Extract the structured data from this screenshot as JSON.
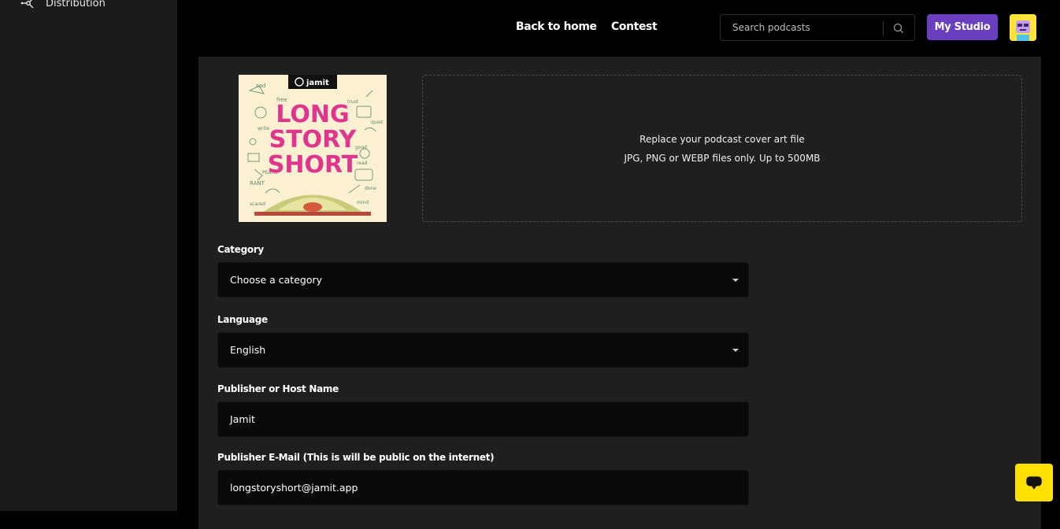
{
  "sidebar": {
    "items": [
      {
        "label": "Distribution",
        "icon": "distribution-icon"
      }
    ]
  },
  "header": {
    "nav": {
      "back_home": "Back to home",
      "contest": "Contest"
    },
    "search": {
      "placeholder": "Search podcasts",
      "icon": "search-icon"
    },
    "studio_button": "My Studio",
    "avatar_icon": "avatar-icon"
  },
  "cover": {
    "brand": "jamit",
    "title_lines": [
      "LONG",
      "STORY",
      "SHORT"
    ],
    "doodles": [
      "sad",
      "free",
      "trust",
      "RANT",
      "good",
      "PEATO",
      "read",
      "quiet",
      "scared",
      "mind",
      "write",
      "done"
    ]
  },
  "dropzone": {
    "line1": "Replace your podcast cover art file",
    "line2": "JPG, PNG or WEBP files only. Up to 500MB"
  },
  "form": {
    "category": {
      "label": "Category",
      "value": "Choose a category"
    },
    "language": {
      "label": "Language",
      "value": "English"
    },
    "publisher": {
      "label": "Publisher or Host Name",
      "value": "Jamit"
    },
    "email": {
      "label": "Publisher E-Mail (This is will be public on the internet)",
      "value": "longstoryshort@jamit.app"
    }
  },
  "chat_icon": "chat-icon",
  "colors": {
    "accent": "#6a3fbf",
    "chat": "#ffe000",
    "panel": "#1f1f1f",
    "sidebar": "#1b1b1b",
    "cover_bg": "#fbf1d2",
    "cover_title": "#e0358c"
  }
}
